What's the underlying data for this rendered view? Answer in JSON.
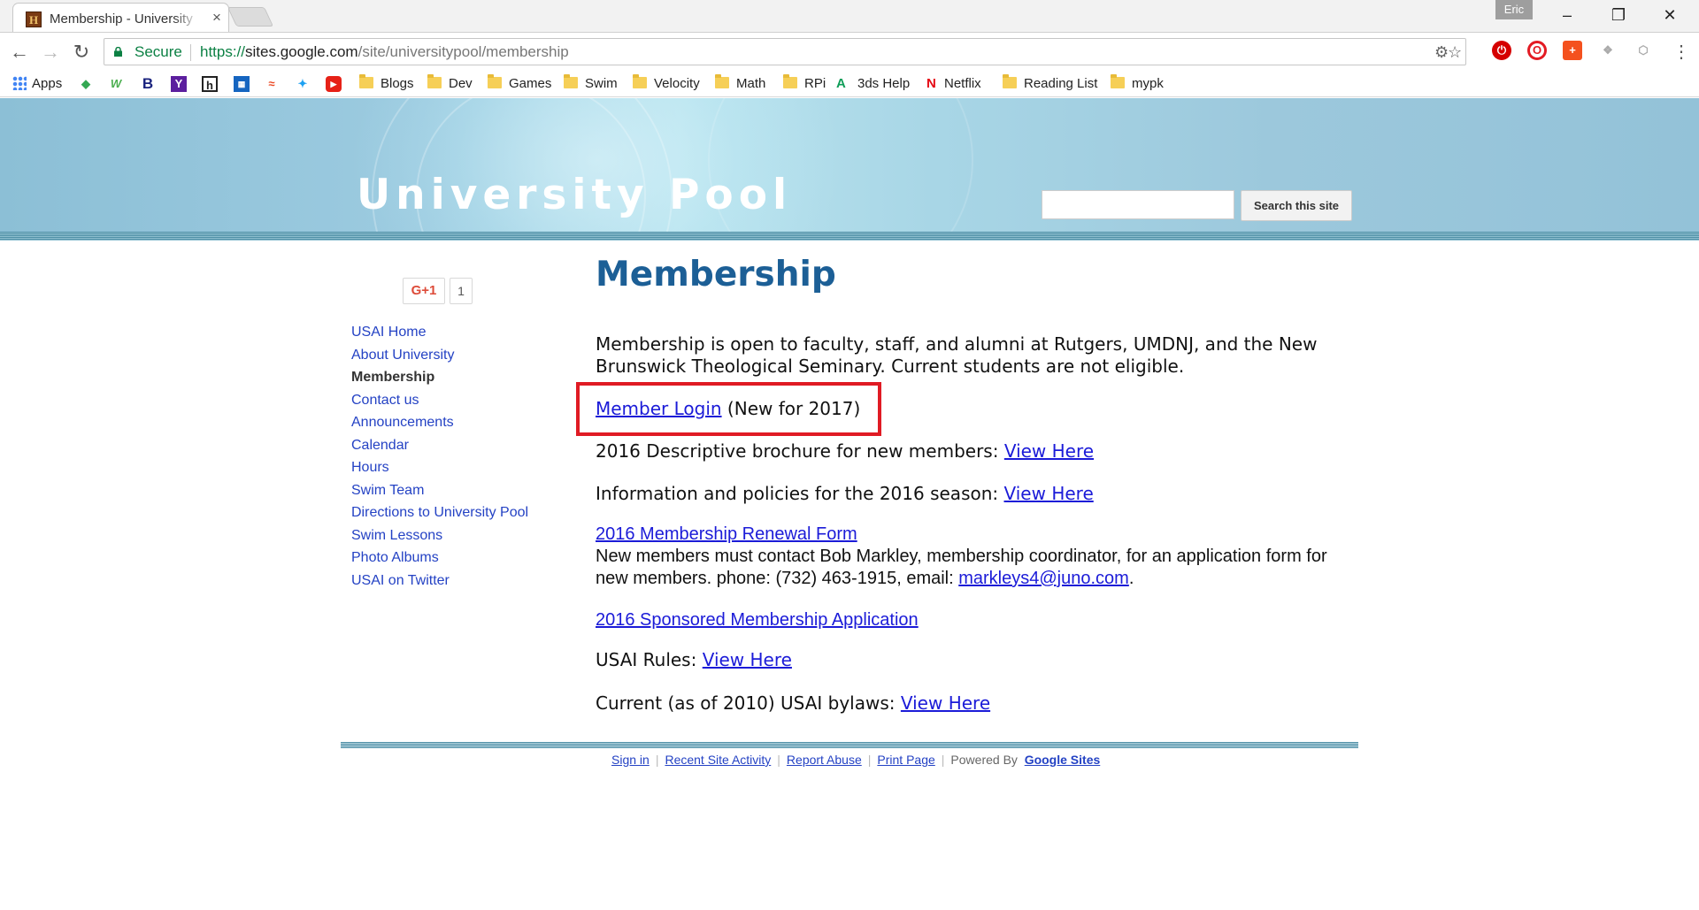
{
  "browser": {
    "tab_title": "Membership - University",
    "tab_favicon_letter": "H",
    "profile_name": "Eric",
    "secure_label": "Secure",
    "url_scheme": "https://",
    "url_host": "sites.google.com",
    "url_path": "/site/universitypool/membership",
    "bookmarks": [
      {
        "label": "Apps",
        "kind": "apps"
      },
      {
        "label": "Blogs",
        "kind": "folder"
      },
      {
        "label": "Dev",
        "kind": "folder"
      },
      {
        "label": "Games",
        "kind": "folder"
      },
      {
        "label": "Swim",
        "kind": "folder"
      },
      {
        "label": "Velocity",
        "kind": "folder"
      },
      {
        "label": "Math",
        "kind": "folder"
      },
      {
        "label": "RPi",
        "kind": "folder"
      },
      {
        "label": "3ds Help",
        "kind": "site"
      },
      {
        "label": "Netflix",
        "kind": "site"
      },
      {
        "label": "Reading List",
        "kind": "folder"
      },
      {
        "label": "mypk",
        "kind": "folder"
      }
    ],
    "bookmark_icons": [
      {
        "name": "maps-icon",
        "glyph": "◆",
        "color": "#34a853"
      },
      {
        "name": "w-icon",
        "glyph": "W",
        "color": "#4caf50"
      },
      {
        "name": "b-icon",
        "glyph": "B",
        "color": "#1a237e"
      },
      {
        "name": "yahoo-icon",
        "glyph": "Y",
        "color": "#5c1f9e"
      },
      {
        "name": "h-icon",
        "glyph": "h",
        "color": "#222222"
      },
      {
        "name": "weather-icon",
        "glyph": "▦",
        "color": "#1565c0"
      },
      {
        "name": "stumble-icon",
        "glyph": "≈",
        "color": "#eb4924"
      },
      {
        "name": "twitter-icon",
        "glyph": "✦",
        "color": "#1da1f2"
      },
      {
        "name": "youtube-icon",
        "glyph": "▶",
        "color": "#e62117"
      }
    ]
  },
  "site": {
    "title": "University Pool",
    "search_button": "Search this site",
    "search_value": "",
    "gplus_label": "G+1",
    "gplus_count": "1"
  },
  "sidebar": {
    "items": [
      {
        "label": "USAI Home",
        "current": false
      },
      {
        "label": "About University",
        "current": false
      },
      {
        "label": "Membership",
        "current": true
      },
      {
        "label": "Contact us",
        "current": false
      },
      {
        "label": "Announcements",
        "current": false
      },
      {
        "label": "Calendar",
        "current": false
      },
      {
        "label": "Hours",
        "current": false
      },
      {
        "label": "Swim Team",
        "current": false
      },
      {
        "label": "Directions to University Pool",
        "current": false
      },
      {
        "label": "Swim Lessons",
        "current": false
      },
      {
        "label": "Photo Albums",
        "current": false
      },
      {
        "label": "USAI on Twitter",
        "current": false
      }
    ]
  },
  "main": {
    "page_title": "Membership",
    "intro_line1": "Membership is open to faculty, staff, and alumni at Rutgers, UMDNJ, and the New",
    "intro_line2": "Brunswick Theological Seminary. Current students are not eligible.",
    "member_login_link": "Member Login",
    "member_login_note": " (New for 2017)",
    "brochure_text": "2016 Descriptive brochure for new members: ",
    "brochure_link": "View Here",
    "policies_text": "Information and policies for the 2016 season: ",
    "policies_link": "View Here",
    "renewal_link": "2016 Membership Renewal Form",
    "new_members_line1": "New members must contact Bob Markley, membership coordinator, for an application form for",
    "new_members_line2_prefix": "new members. phone: (732) 463-1915, email: ",
    "email_link": "markleys4@juno.com",
    "new_members_line2_suffix": ".",
    "sponsored_link": "2016 Sponsored Membership Application",
    "rules_text": "USAI Rules: ",
    "rules_link": "View Here",
    "bylaws_text": "Current (as of 2010) USAI bylaws: ",
    "bylaws_link": "View Here"
  },
  "footer": {
    "sign_in": "Sign in",
    "recent_activity": "Recent Site Activity",
    "report_abuse": "Report Abuse",
    "print_page": "Print Page",
    "powered_by": "Powered By",
    "google_sites": "Google Sites"
  },
  "colors": {
    "accent_blue": "#1c5f96",
    "link_blue": "#2442c4",
    "highlight_red": "#e01b24",
    "header_teal": "#9cc8dc"
  }
}
